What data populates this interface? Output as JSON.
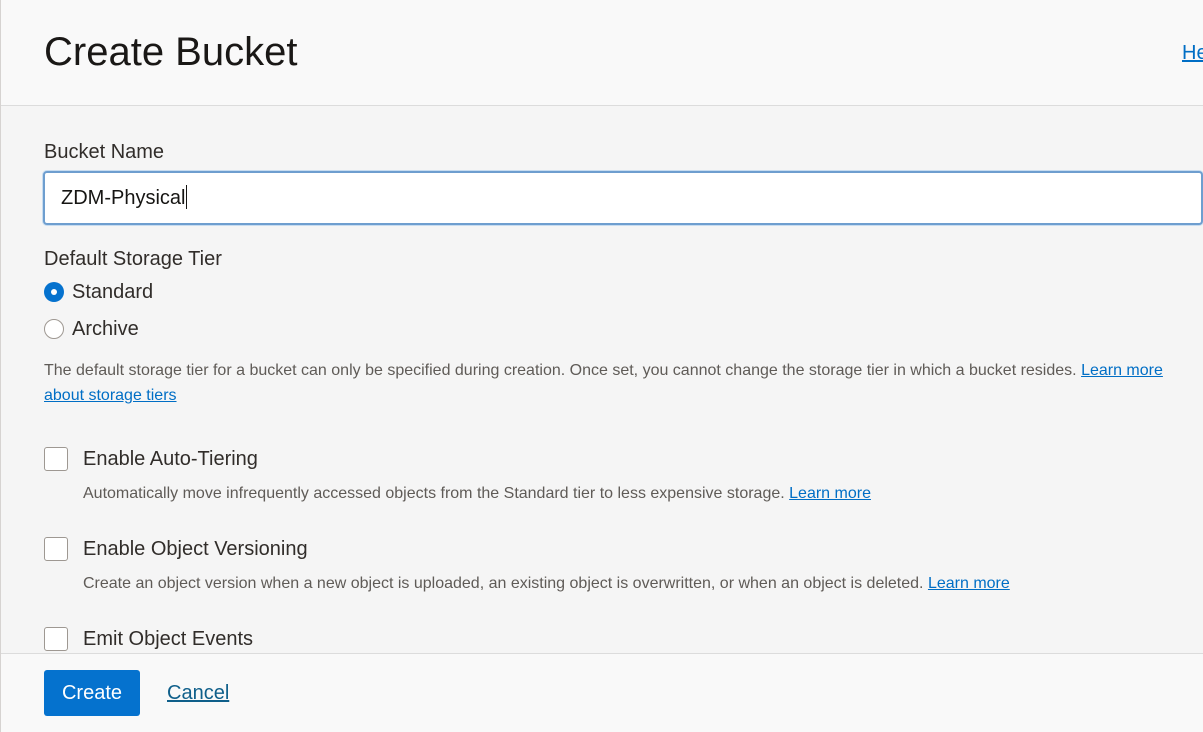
{
  "header": {
    "title": "Create Bucket",
    "help_label": "He"
  },
  "form": {
    "bucket_name_label": "Bucket Name",
    "bucket_name_value": "ZDM-Physical",
    "storage_tier_label": "Default Storage Tier",
    "storage_tier_options": [
      {
        "label": "Standard",
        "selected": true
      },
      {
        "label": "Archive",
        "selected": false
      }
    ],
    "storage_tier_hint": "The default storage tier for a bucket can only be specified during creation. Once set, you cannot change the storage tier in which a bucket resides.",
    "storage_tier_link": "Learn more about storage tiers",
    "options": [
      {
        "label": "Enable Auto-Tiering",
        "checked": false,
        "hint": "Automatically move infrequently accessed objects from the Standard tier to less expensive storage.",
        "link": "Learn more"
      },
      {
        "label": "Enable Object Versioning",
        "checked": false,
        "hint": "Create an object version when a new object is uploaded, an existing object is overwritten, or when an object is deleted.",
        "link": "Learn more"
      },
      {
        "label": "Emit Object Events",
        "checked": false
      }
    ]
  },
  "footer": {
    "create_label": "Create",
    "cancel_label": "Cancel"
  },
  "colors": {
    "primary": "#0572ce",
    "link": "#006ec5",
    "focus_border": "#6e9ecf"
  }
}
